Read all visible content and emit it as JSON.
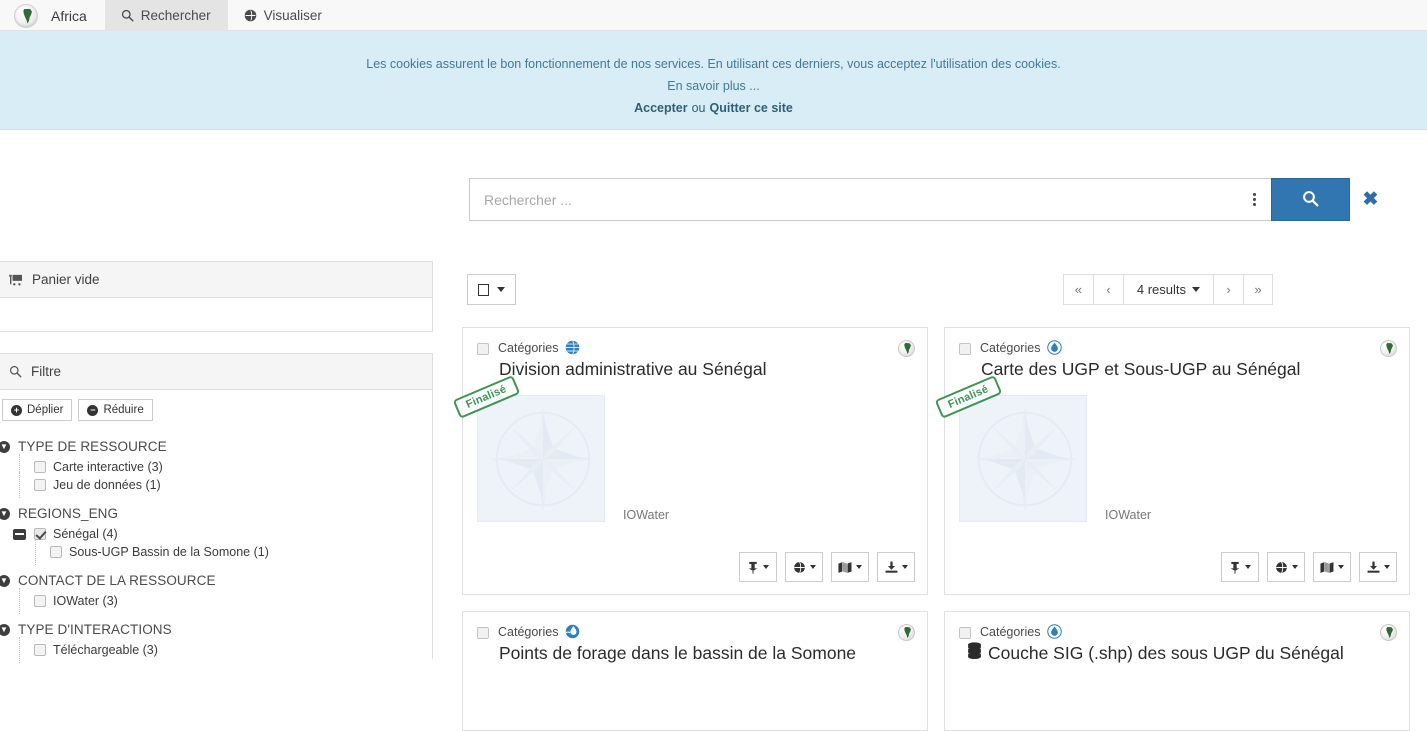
{
  "nav": {
    "brand": {
      "label": "Africa",
      "icon": "globe-africa-icon"
    },
    "tabs": [
      {
        "label": "Rechercher",
        "icon": "search-icon",
        "active": true
      },
      {
        "label": "Visualiser",
        "icon": "globe-icon",
        "active": false
      }
    ]
  },
  "cookie_banner": {
    "message": "Les cookies assurent le bon fonctionnement de nos services. En utilisant ces derniers, vous acceptez l'utilisation des cookies.",
    "learn_more": "En savoir plus ...",
    "accept": "Accepter",
    "or": "ou",
    "quit": "Quitter ce site",
    "background": "#d9edf7",
    "text_color": "#31708f"
  },
  "search": {
    "placeholder": "Rechercher ...",
    "value": "",
    "kebab_icon": "more-options-icon",
    "submit_icon": "search-icon",
    "close_icon": "close-icon",
    "button_color": "#3276b1"
  },
  "sidebar": {
    "basket": {
      "title": "Panier vide",
      "icon": "cart-icon"
    },
    "filter": {
      "title": "Filtre",
      "icon": "search-icon",
      "expand_label": "Déplier",
      "collapse_label": "Réduire",
      "facets": [
        {
          "title": "TYPE DE RESSOURCE",
          "items": [
            {
              "label": "Carte interactive (3)",
              "checked": false,
              "level": 1
            },
            {
              "label": "Jeu de données (1)",
              "checked": false,
              "level": 1
            }
          ]
        },
        {
          "title": "REGIONS_ENG",
          "items": [
            {
              "label": "Sénégal (4)",
              "checked": true,
              "level": 1,
              "expander": "minus"
            },
            {
              "label": "Sous-UGP Bassin de la Somone (1)",
              "checked": false,
              "level": 2
            }
          ]
        },
        {
          "title": "CONTACT DE LA RESSOURCE",
          "items": [
            {
              "label": "IOWater (3)",
              "checked": false,
              "level": 1
            }
          ]
        },
        {
          "title": "TYPE D'INTERACTIONS",
          "items": [
            {
              "label": "Téléchargeable (3)",
              "checked": false,
              "level": 1
            }
          ]
        }
      ]
    }
  },
  "results": {
    "select_all_icon": "checkbox-icon",
    "pager": {
      "first": "«",
      "prev": "‹",
      "count_label": "4 results",
      "next": "›",
      "last": "»"
    },
    "cards": [
      {
        "category_label": "Catégories",
        "category_icon": "globe-blue-icon",
        "title": "Division administrative au Sénégal",
        "title_icon": null,
        "stamp": "Finalisé",
        "owner": "IOWater",
        "thumbnail": "compass-rose-placeholder",
        "region_icon": "africa-globe-icon",
        "actions": [
          {
            "icon": "pin-icon"
          },
          {
            "icon": "globe-icon"
          },
          {
            "icon": "map-icon"
          },
          {
            "icon": "download-icon"
          }
        ]
      },
      {
        "category_label": "Catégories",
        "category_icon": "water-drop-icon",
        "title": "Carte des UGP et Sous-UGP au Sénégal",
        "title_icon": null,
        "stamp": "Finalisé",
        "owner": "IOWater",
        "thumbnail": "compass-rose-placeholder",
        "region_icon": "africa-globe-icon",
        "actions": [
          {
            "icon": "pin-icon"
          },
          {
            "icon": "globe-icon"
          },
          {
            "icon": "map-icon"
          },
          {
            "icon": "download-icon"
          }
        ]
      },
      {
        "category_label": "Catégories",
        "category_icon": "water-globe-icon",
        "title": "Points de forage dans le bassin de la Somone",
        "title_icon": null,
        "region_icon": "africa-globe-icon"
      },
      {
        "category_label": "Catégories",
        "category_icon": "water-drop-icon",
        "title": "Couche SIG (.shp) des sous UGP du Sénégal",
        "title_icon": "database-icon",
        "region_icon": "africa-globe-icon"
      }
    ]
  }
}
